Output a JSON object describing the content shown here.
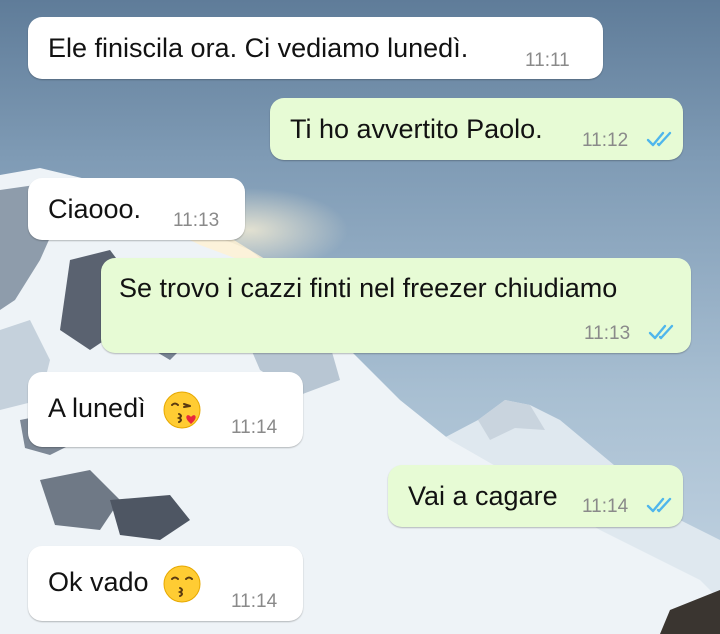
{
  "messages": [
    {
      "direction": "incoming",
      "text": "Ele finiscila ora. Ci vediamo lunedì.",
      "time": "11:11"
    },
    {
      "direction": "outgoing",
      "text": "Ti ho avvertito Paolo.",
      "time": "11:12",
      "status_icon": "double-check-read-icon"
    },
    {
      "direction": "incoming",
      "text": "Ciaooo.",
      "time": "11:13"
    },
    {
      "direction": "outgoing",
      "text": "Se trovo i cazzi finti nel freezer chiudiamo",
      "time": "11:13",
      "status_icon": "double-check-read-icon"
    },
    {
      "direction": "incoming",
      "text": "A lunedì",
      "time": "11:14",
      "emoji": "face-blowing-kiss-emoji"
    },
    {
      "direction": "outgoing",
      "text": "Vai a cagare",
      "time": "11:14",
      "status_icon": "double-check-read-icon"
    },
    {
      "direction": "incoming",
      "text": "Ok vado",
      "time": "11:14",
      "emoji": "kissing-face-emoji"
    }
  ],
  "colors": {
    "incoming_bubble": "#ffffff",
    "outgoing_bubble": "#e7fbd5",
    "read_ticks": "#4fb6ec",
    "timestamp": "#8a8a8a"
  }
}
